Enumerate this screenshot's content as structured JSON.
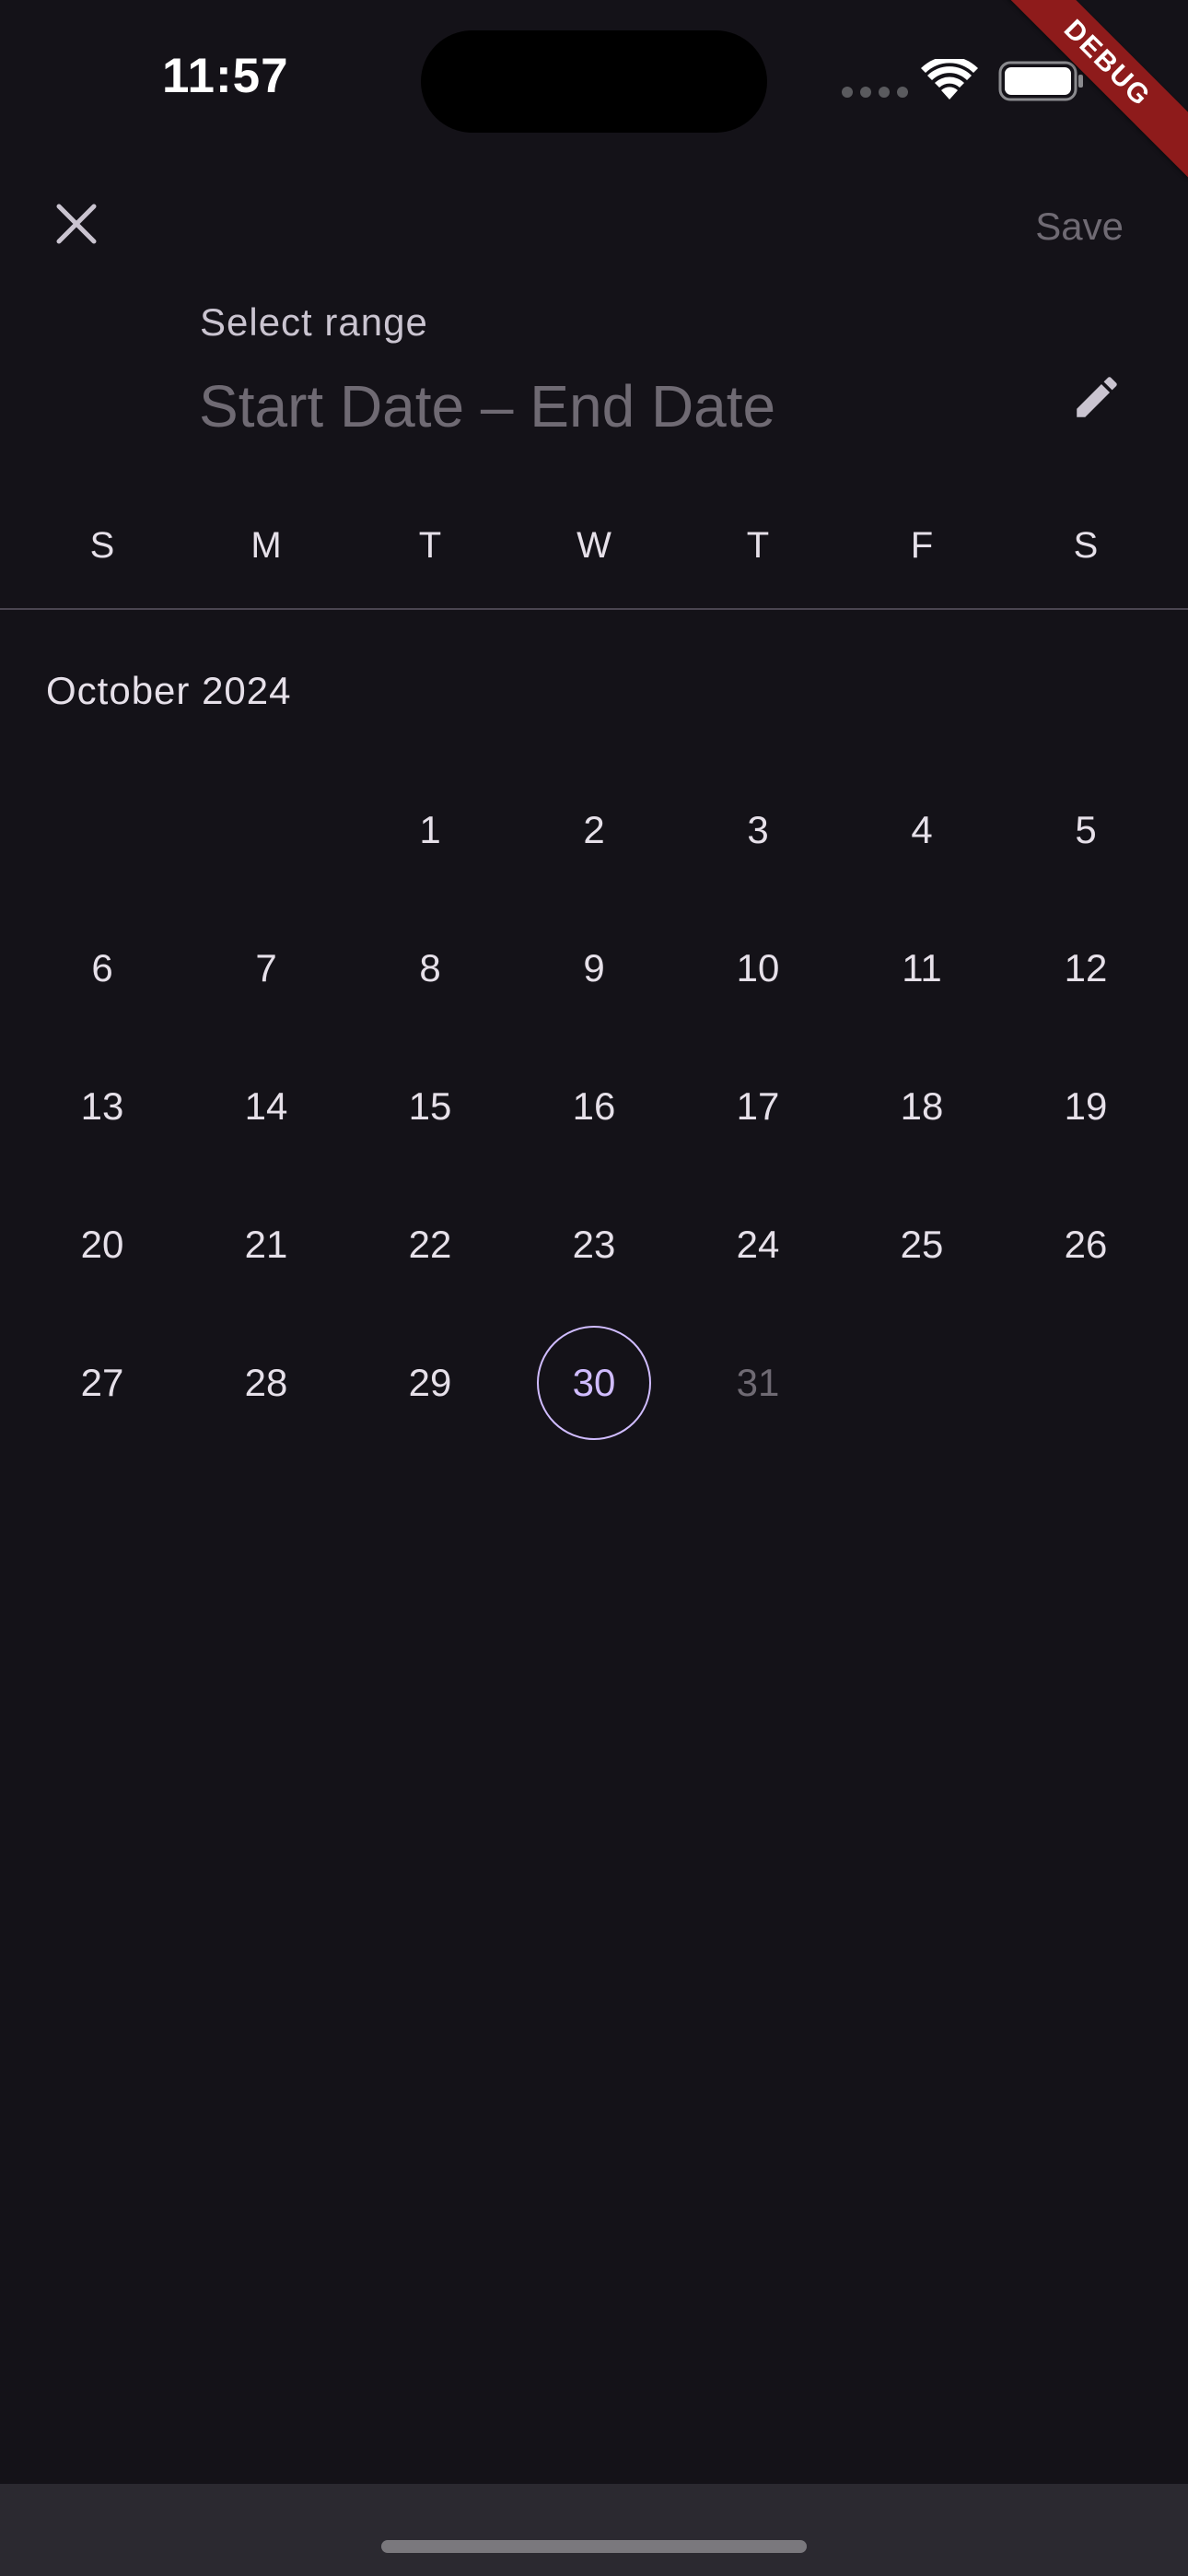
{
  "status_bar": {
    "time": "11:57"
  },
  "debug_banner": "DEBUG",
  "toolbar": {
    "save_label": "Save"
  },
  "header": {
    "label": "Select range",
    "range_placeholder": "Start Date – End Date"
  },
  "weekdays": [
    "S",
    "M",
    "T",
    "W",
    "T",
    "F",
    "S"
  ],
  "calendar": {
    "month_title": "October 2024",
    "leading_blanks": 2,
    "days": [
      "1",
      "2",
      "3",
      "4",
      "5",
      "6",
      "7",
      "8",
      "9",
      "10",
      "11",
      "12",
      "13",
      "14",
      "15",
      "16",
      "17",
      "18",
      "19",
      "20",
      "21",
      "22",
      "23",
      "24",
      "25",
      "26",
      "27",
      "28",
      "29",
      "30",
      "31"
    ],
    "today": "30",
    "disabled_days": [
      "31"
    ]
  },
  "colors": {
    "background": "#141218",
    "accent": "#D0BCFF",
    "muted": "#6F6A73",
    "debug": "#8E1B1B"
  }
}
